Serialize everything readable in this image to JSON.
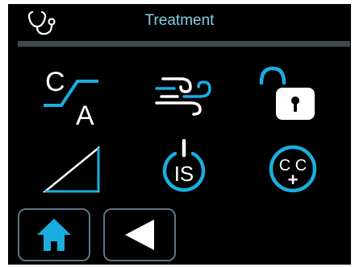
{
  "header": {
    "title": "Treatment",
    "icon": "stethoscope-icon"
  },
  "colors": {
    "accent": "#1aaee0",
    "title": "#7fcfe4",
    "header_bar": "#3b4a54",
    "background": "#000000",
    "icon_white": "#ffffff",
    "button_border": "#5c7585"
  },
  "grid": {
    "ca_switch": {
      "icon": "ca-switch-icon",
      "top_letter": "C",
      "bottom_letter": "A"
    },
    "wind": {
      "icon": "wind-icon"
    },
    "lock": {
      "icon": "unlocked-padlock-icon"
    },
    "ramp": {
      "icon": "ramp-triangle-icon"
    },
    "is_power": {
      "icon": "is-power-icon",
      "label": "IS"
    },
    "cc_plus": {
      "icon": "cc-plus-icon",
      "label": "C C",
      "sign": "+"
    }
  },
  "nav": {
    "home": {
      "icon": "home-icon"
    },
    "back": {
      "icon": "back-triangle-icon"
    }
  }
}
